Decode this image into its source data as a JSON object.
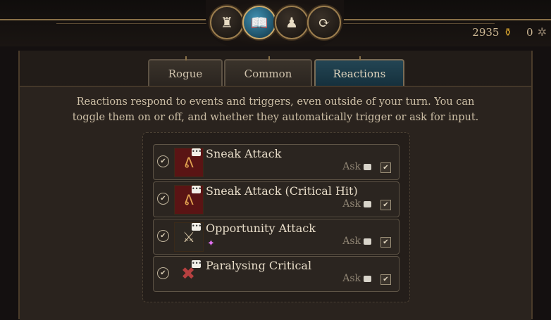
{
  "top_icons": [
    {
      "name": "armor",
      "glyph": "♜",
      "active": false
    },
    {
      "name": "spellbook",
      "glyph": "📖",
      "active": true
    },
    {
      "name": "character",
      "glyph": "♟",
      "active": false
    },
    {
      "name": "reactions-swirl",
      "glyph": "⟳",
      "active": false
    }
  ],
  "currency": {
    "gold": "2935",
    "gold_icon": "coin-icon",
    "other": "0",
    "other_icon": "gear-icon"
  },
  "tabs": [
    {
      "label": "Rogue",
      "active": false
    },
    {
      "label": "Common",
      "active": false
    },
    {
      "label": "Reactions",
      "active": true
    }
  ],
  "description": "Reactions respond to events and triggers, even outside of your turn. You can toggle them on or off, and whether they automatically trigger or ask for input.",
  "reactions": [
    {
      "name": "Sneak Attack",
      "enabled": true,
      "mode": "Ask",
      "ask_checked": true,
      "icon": "sneak-attack-icon"
    },
    {
      "name": "Sneak Attack (Critical Hit)",
      "enabled": true,
      "mode": "Ask",
      "ask_checked": true,
      "icon": "sneak-attack-crit-icon"
    },
    {
      "name": "Opportunity Attack",
      "enabled": true,
      "mode": "Ask",
      "ask_checked": true,
      "icon": "opportunity-attack-icon",
      "spark": "✦"
    },
    {
      "name": "Paralysing Critical",
      "enabled": true,
      "mode": "Ask",
      "ask_checked": true,
      "icon": "paralysing-critical-icon"
    }
  ],
  "colors": {
    "accent_gold": "#9c7e4e",
    "active_tab": "#234554",
    "text": "#e7dcc8"
  }
}
